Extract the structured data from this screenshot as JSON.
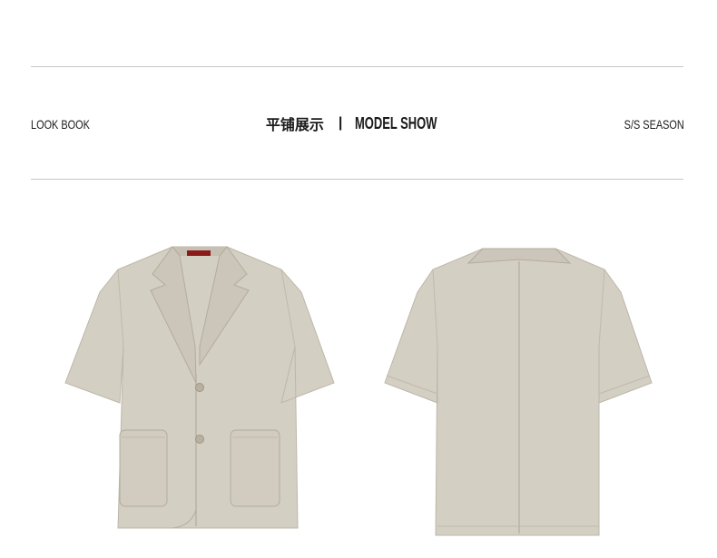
{
  "header": {
    "left_label": "LOOK BOOK",
    "center_title_cn": "平铺展示",
    "separator": "|",
    "center_title_en": "MODEL SHOW",
    "right_label": "S/S SEASON"
  },
  "products": {
    "front_view": {
      "description_icon": "jacket-front-image"
    },
    "back_view": {
      "description_icon": "jacket-back-image"
    }
  },
  "colors": {
    "fabric": "#d4cfc3",
    "fabric_shadow": "#bdb7a9",
    "rule": "#c9c9c9",
    "text": "#1a1a1a",
    "label_red": "#8b1a1a"
  }
}
